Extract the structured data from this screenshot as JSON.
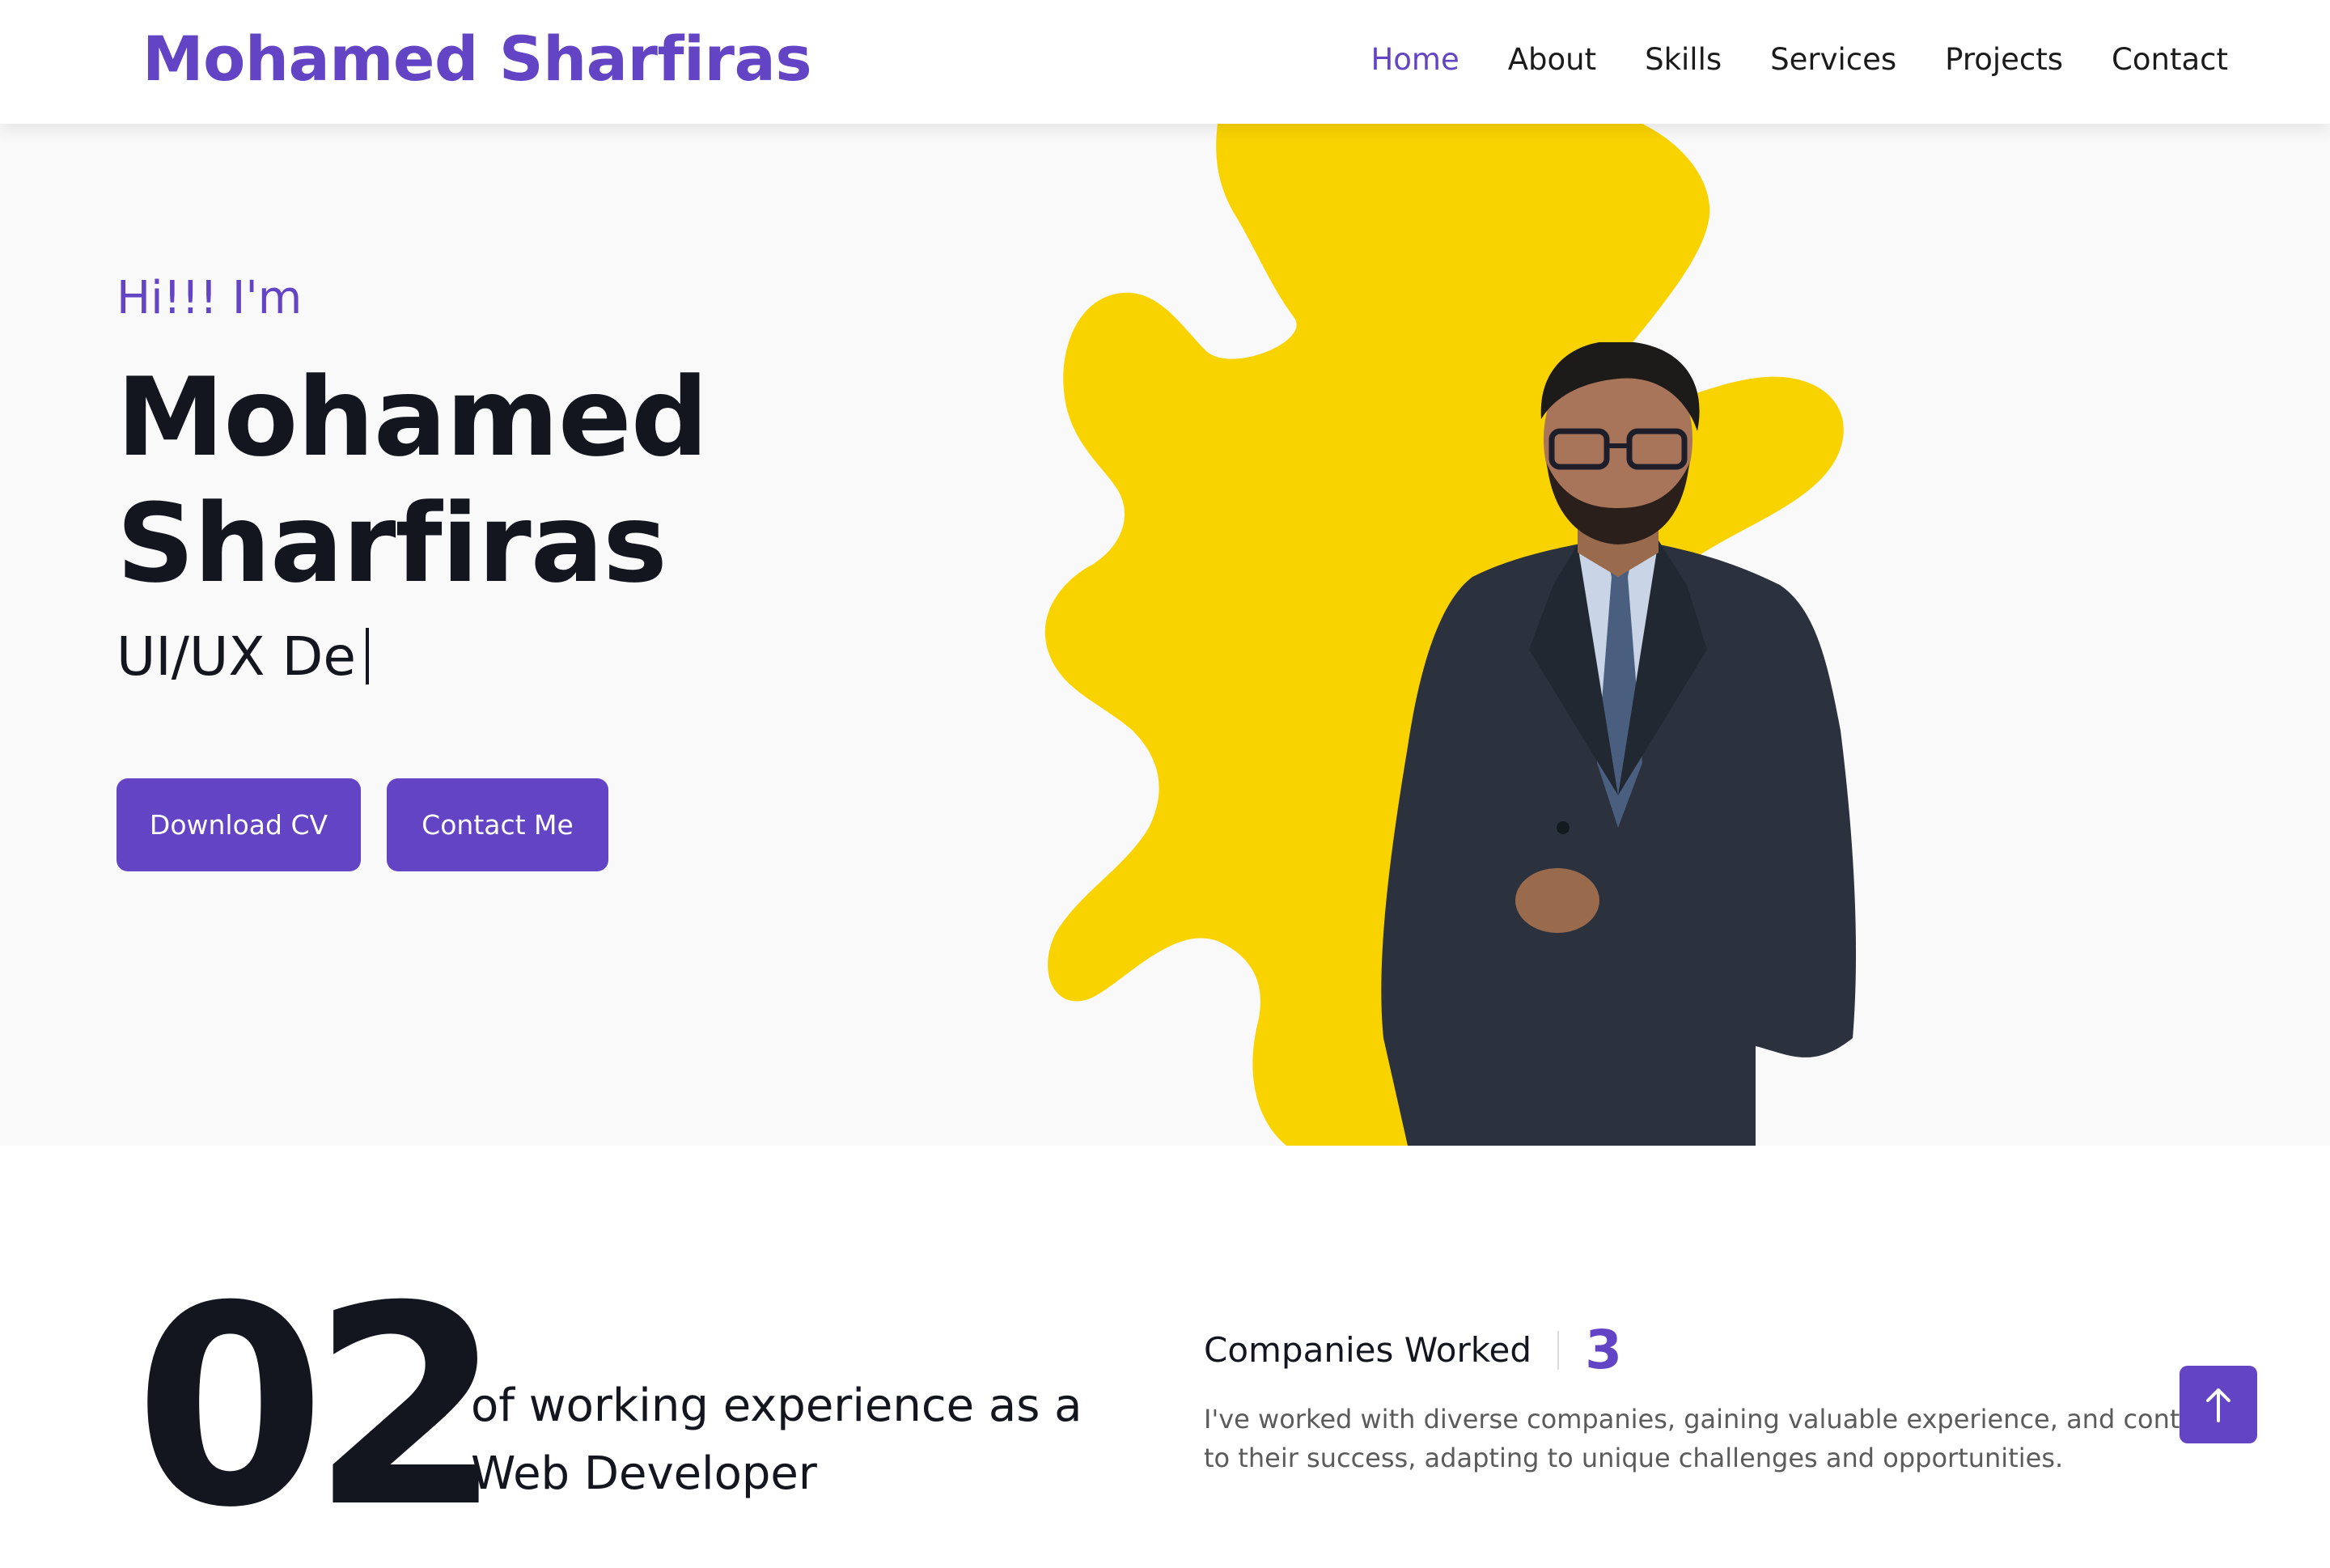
{
  "header": {
    "logo": "Mohamed Sharfiras",
    "nav": [
      {
        "label": "Home",
        "active": true
      },
      {
        "label": "About"
      },
      {
        "label": "Skills"
      },
      {
        "label": "Services"
      },
      {
        "label": "Projects"
      },
      {
        "label": "Contact"
      }
    ]
  },
  "hero": {
    "greeting": "Hi!!! I'm",
    "name_line1": "Mohamed",
    "name_line2": "Sharfiras",
    "typed_text": "UI/UX De",
    "download_cv_label": "Download CV",
    "contact_me_label": "Contact Me",
    "splash_color": "#f9d300"
  },
  "stats": {
    "years": "02",
    "experience_line1": "of working experience as a",
    "experience_line2": "Web Developer",
    "companies_label": "Companies Worked",
    "companies_count": "3",
    "companies_desc_line1": "I've worked with diverse companies, gaining valuable experience, and contributing",
    "companies_desc_line2": "to their success, adapting to unique challenges and opportunities."
  },
  "scroll_top": {
    "icon": "arrow-up-icon"
  },
  "colors": {
    "accent": "#6244c5",
    "text": "#13151f",
    "hero_bg": "#f9f9f9"
  }
}
